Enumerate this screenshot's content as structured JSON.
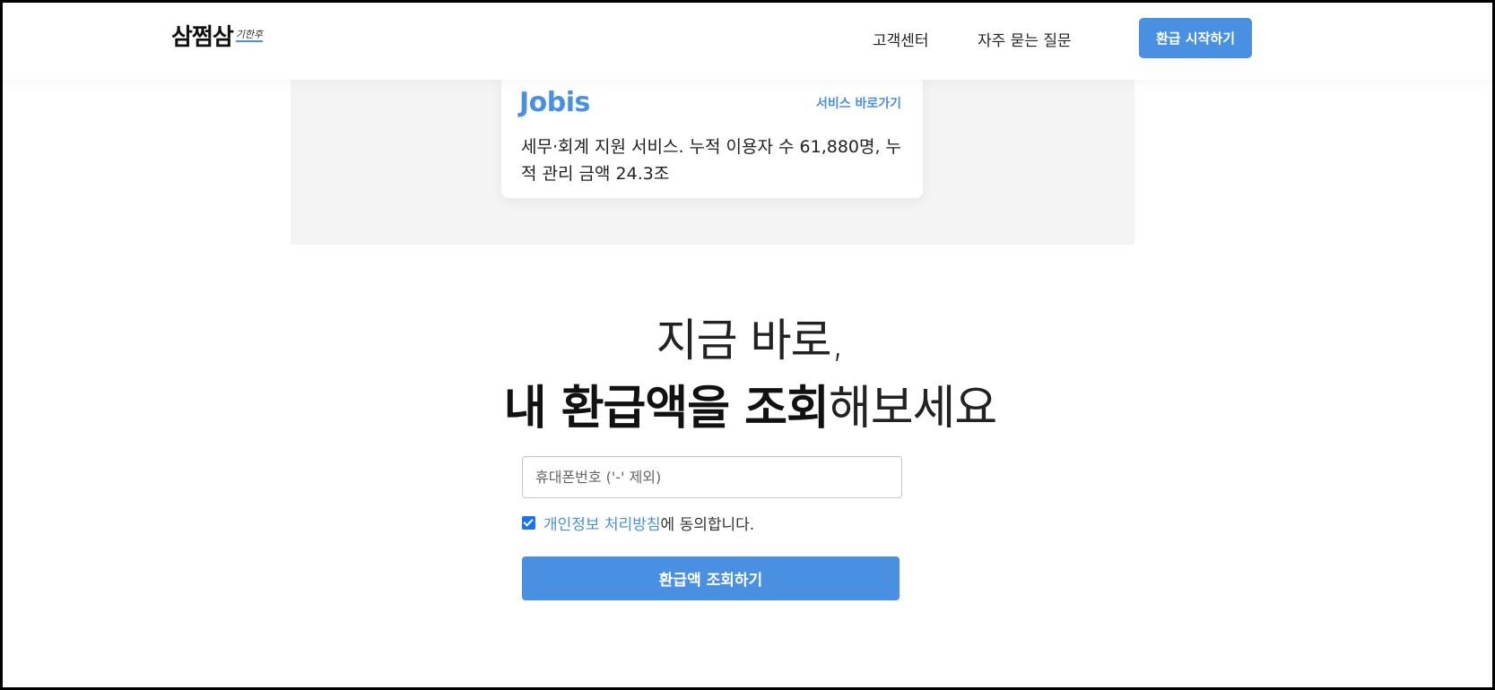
{
  "header": {
    "logo_main": "삼쩜삼",
    "logo_sub": "기한후",
    "nav": {
      "customer_center": "고객센터",
      "faq": "자주 묻는 질문"
    },
    "start_button": "환급 시작하기"
  },
  "service_card": {
    "brand": "Jobis",
    "link_label": "서비스 바로가기",
    "description": "세무·회계 지원 서비스. 누적 이용자 수 61,880명, 누적 관리 금액 24.3조"
  },
  "hero": {
    "line1": "지금 바로,",
    "line2_strong": "내 환급액을 조회",
    "line2_light": "해보세요"
  },
  "form": {
    "phone_placeholder": "휴대폰번호 ('-' 제외)",
    "phone_value": "",
    "agree_checked": true,
    "agree_link": "개인정보 처리방침",
    "agree_suffix": "에 동의합니다.",
    "submit_label": "환급액 조회하기"
  },
  "colors": {
    "accent": "#4a90e2",
    "band": "#f4f4f4"
  }
}
